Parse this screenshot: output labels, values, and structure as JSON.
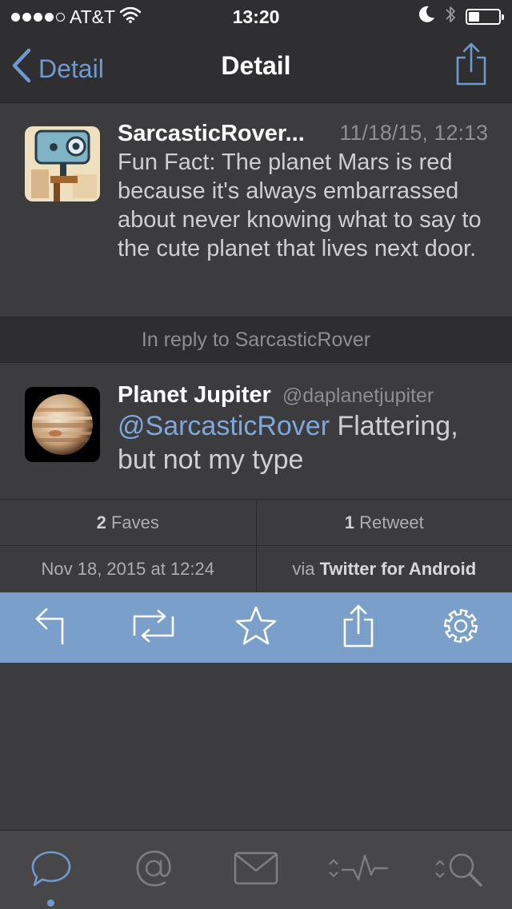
{
  "status_bar": {
    "carrier": "AT&T",
    "time": "13:20",
    "signal_bars": 4,
    "signal_total": 5,
    "battery_level": 0.35
  },
  "nav": {
    "back_label": "Detail",
    "title": "Detail",
    "accent_color": "#6f9ad0"
  },
  "tweet": {
    "author": "SarcasticRover...",
    "date": "11/18/15, 12:13",
    "text": "Fun Fact: The planet Mars is red because it's always embarrassed about never knowing what to say to the cute planet that lives next door."
  },
  "reply_context": "In reply to SarcasticRover",
  "reply": {
    "author": "Planet Jupiter",
    "handle": "@daplanetjupiter",
    "mention": "@SarcasticRover",
    "text": " Flattering, but not my type"
  },
  "stats": {
    "faves_count": "2",
    "faves_label": "Faves",
    "retweets_count": "1",
    "retweets_label": "Retweet"
  },
  "meta": {
    "timestamp": "Nov 18, 2015 at 12:24",
    "via_prefix": "via",
    "client": "Twitter for Android"
  },
  "actions": [
    "reply-icon",
    "retweet-icon",
    "star-icon",
    "share-icon",
    "gear-icon"
  ],
  "tabs": [
    {
      "icon": "speech-bubble-icon",
      "selected": true
    },
    {
      "icon": "at-sign-icon",
      "selected": false
    },
    {
      "icon": "envelope-icon",
      "selected": false
    },
    {
      "icon": "activity-icon",
      "selected": false
    },
    {
      "icon": "search-icon",
      "selected": false
    }
  ],
  "colors": {
    "background": "#3c3c3e",
    "action_bar": "#7a9fcb",
    "tab_icon": "#7d7d82",
    "tab_icon_active": "#6f9ad0"
  }
}
